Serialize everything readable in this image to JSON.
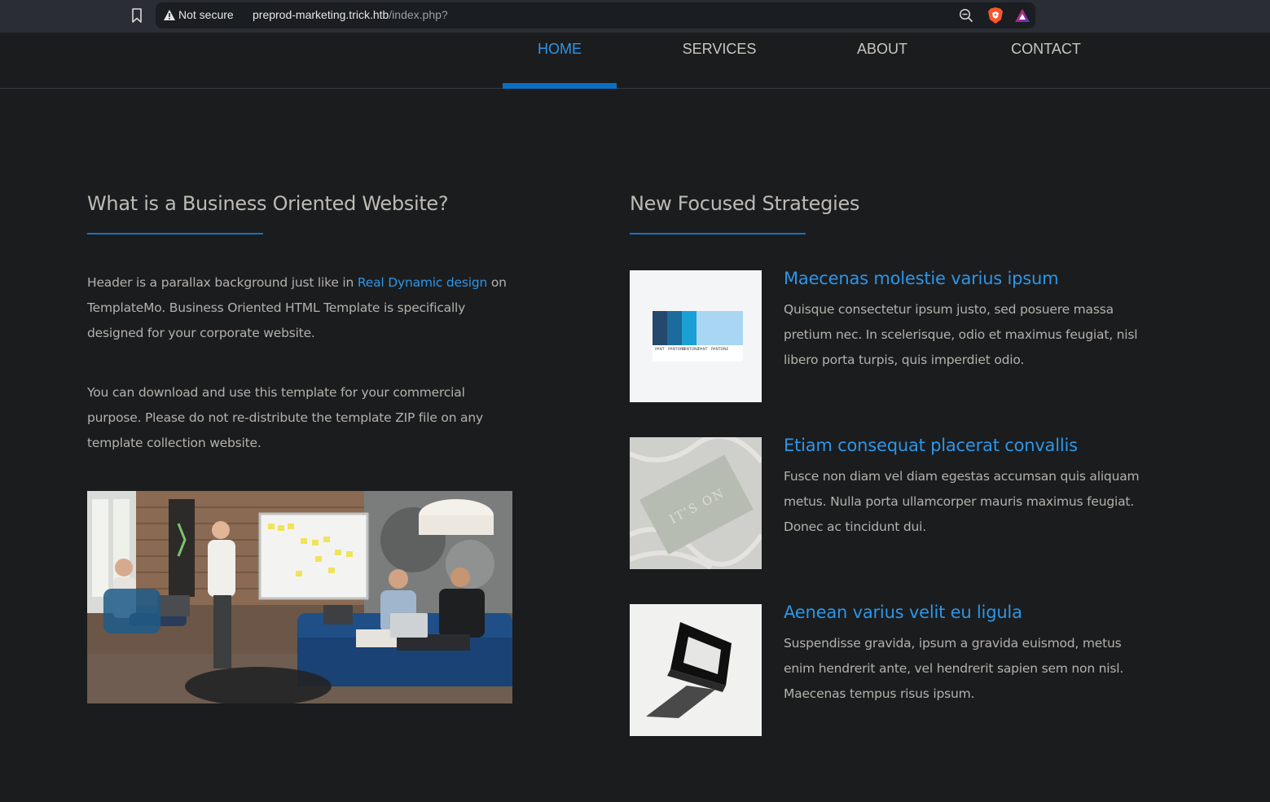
{
  "browser": {
    "security_label": "Not secure",
    "url_host": "preprod-marketing.trick.htb",
    "url_path": "/index.php?",
    "icons": [
      "bookmark-icon",
      "warning-triangle-icon",
      "zoom-out-icon",
      "brave-shields-icon",
      "brave-rewards-icon"
    ]
  },
  "nav": {
    "items": [
      {
        "label": "HOME"
      },
      {
        "label": "SERVICES"
      },
      {
        "label": "ABOUT"
      },
      {
        "label": "CONTACT"
      }
    ],
    "active_color": "#2d96e6"
  },
  "left": {
    "title": "What is a Business Oriented Website?",
    "para1_before": "Header is a parallax background just like in ",
    "para1_link": "Real Dynamic design",
    "para1_after": " on TemplateMo. Business Oriented HTML Template is specifically designed for your corporate website.",
    "para2": "You can download and use this template for your commercial purpose. Please do not re-distribute the template ZIP file on any template collection website."
  },
  "right": {
    "title": "New Focused Strategies",
    "items": [
      {
        "title": "Maecenas molestie varius ipsum",
        "desc": "Quisque consectetur ipsum justo, sed posuere massa pretium nec. In scelerisque, odio et maximus feugiat, nisl libero porta turpis, quis imperdiet odio.",
        "thumb_text": [
          "PANT",
          "PANTONE",
          "PANTONE",
          "PANT",
          "PANTONE"
        ]
      },
      {
        "title": "Etiam consequat placerat convallis",
        "desc": "Fusce non diam vel diam egestas accumsan quis aliquam metus. Nulla porta ullamcorper mauris maximus feugiat. Donec ac tincidunt dui.",
        "thumb_text": "IT'S ON"
      },
      {
        "title": "Aenean varius velit eu ligula",
        "desc": "Suspendisse gravida, ipsum a gravida euismod, metus enim hendrerit ante, vel hendrerit sapien sem non nisl. Maecenas tempus risus ipsum."
      }
    ]
  },
  "colors": {
    "background": "#1b1c1e",
    "accent": "#1672c4",
    "link": "#2d96e6"
  }
}
